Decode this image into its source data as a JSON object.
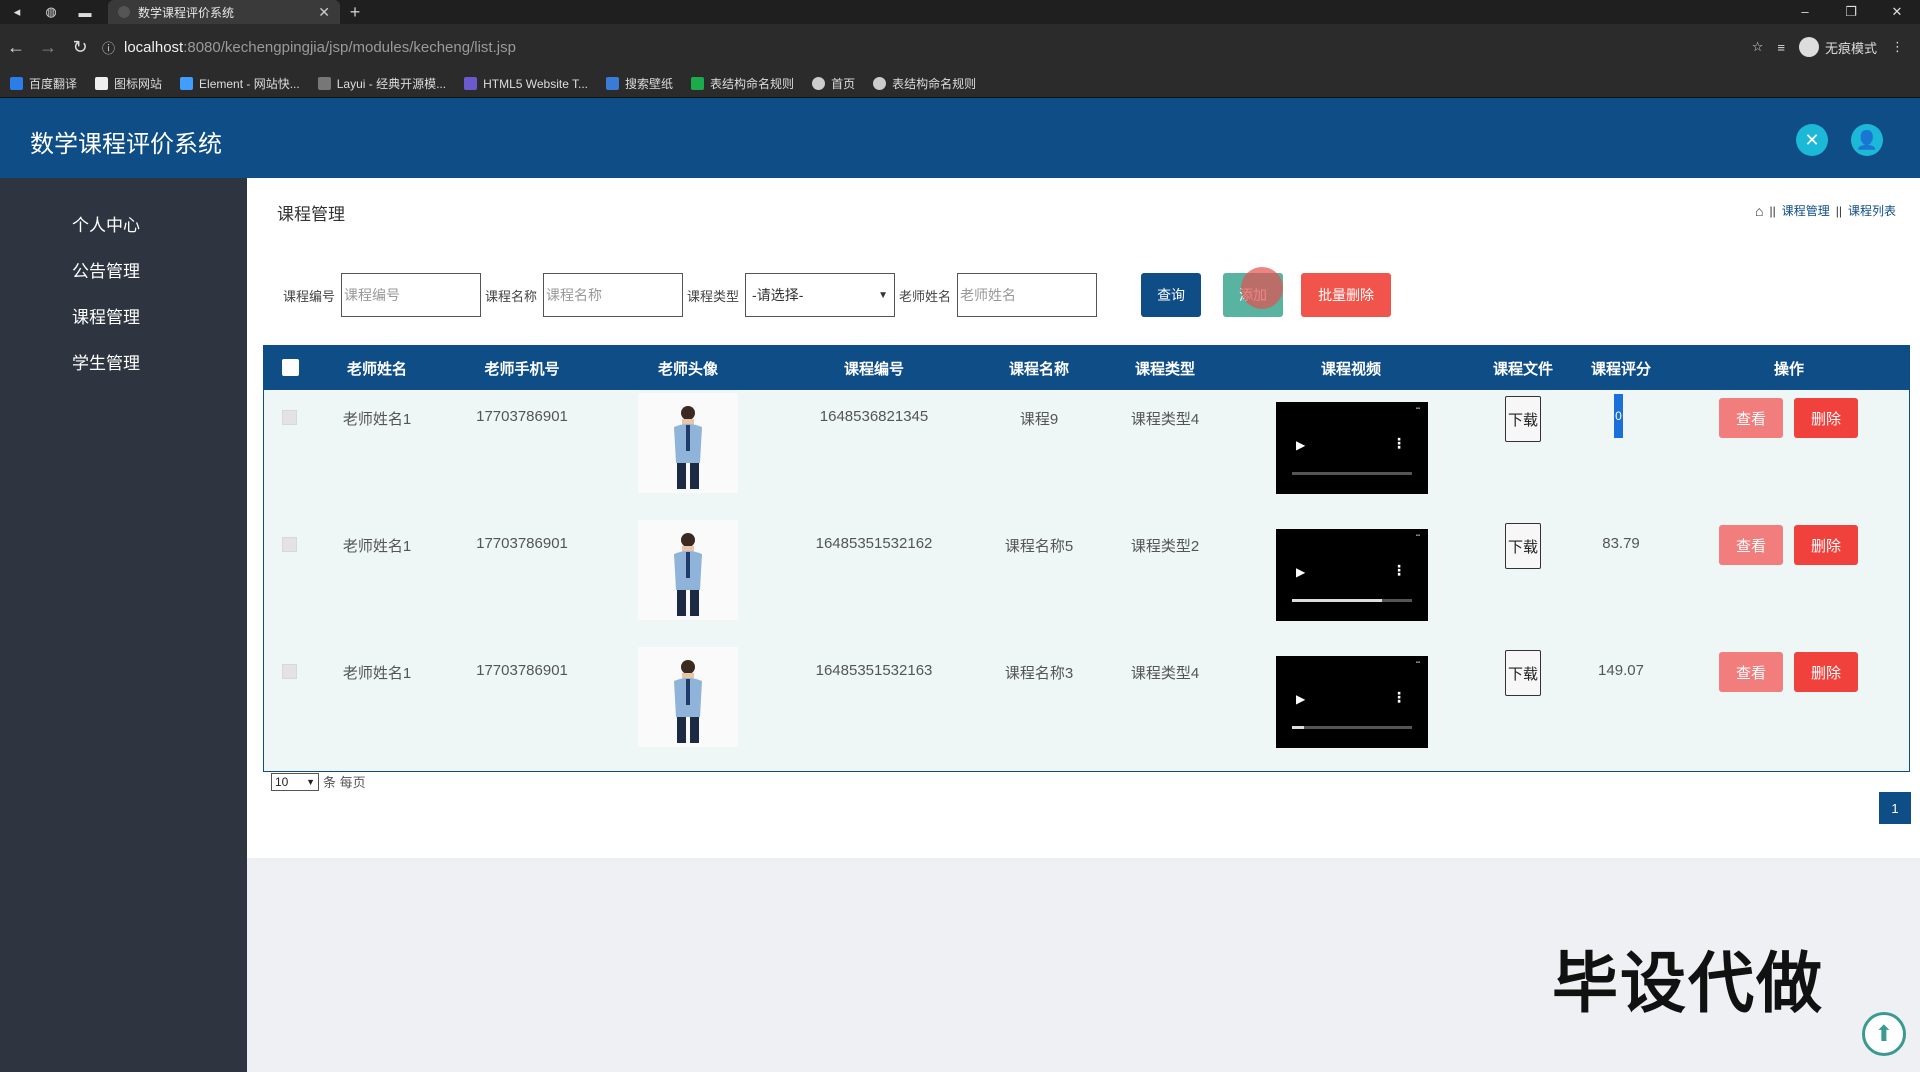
{
  "browser": {
    "tab_title": "数学课程评价系统",
    "url_host": "localhost",
    "url_path": ":8080/kechengpingjia/jsp/modules/kecheng/list.jsp",
    "profile_label": "无痕模式",
    "bookmarks": [
      "百度翻译",
      "图标网站",
      "Element - 网站快...",
      "Layui - 经典开源模...",
      "HTML5 Website T...",
      "搜索壁纸",
      "表结构命名规则",
      "首页",
      "表结构命名规则"
    ]
  },
  "app": {
    "title": "数学课程评价系统",
    "colors": {
      "header": "#0f4d86",
      "sidebar": "#2e3440",
      "accent": "#1bb8d8"
    }
  },
  "sidebar": {
    "items": [
      {
        "label": "个人中心"
      },
      {
        "label": "公告管理"
      },
      {
        "label": "课程管理"
      },
      {
        "label": "学生管理"
      }
    ]
  },
  "page": {
    "title": "课程管理",
    "breadcrumb": [
      "课程管理",
      "课程列表"
    ]
  },
  "search": {
    "course_no_label": "课程编号",
    "course_no_placeholder": "课程编号",
    "course_name_label": "课程名称",
    "course_name_placeholder": "课程名称",
    "course_type_label": "课程类型",
    "course_type_value": "-请选择-",
    "teacher_label": "老师姓名",
    "teacher_placeholder": "老师姓名",
    "query_label": "查询",
    "add_label": "添加",
    "batch_delete_label": "批量删除"
  },
  "table": {
    "headers": [
      "老师姓名",
      "老师手机号",
      "老师头像",
      "课程编号",
      "课程名称",
      "课程类型",
      "课程视频",
      "课程文件",
      "课程评分",
      "操作"
    ],
    "rows": [
      {
        "teacher": "老师姓名1",
        "phone": "17703786901",
        "course_no": "1648536821345",
        "course_name": "课程9",
        "course_type": "课程类型4",
        "file_label": "下载",
        "score": "0",
        "video_progress": 0.0
      },
      {
        "teacher": "老师姓名1",
        "phone": "17703786901",
        "course_no": "16485351532162",
        "course_name": "课程名称5",
        "course_type": "课程类型2",
        "file_label": "下载",
        "score": "83.79",
        "video_progress": 0.75
      },
      {
        "teacher": "老师姓名1",
        "phone": "17703786901",
        "course_no": "16485351532163",
        "course_name": "课程名称3",
        "course_type": "课程类型4",
        "file_label": "下载",
        "score": "149.07",
        "video_progress": 0.1
      }
    ],
    "view_label": "查看",
    "delete_label": "删除"
  },
  "pager": {
    "page_size": "10",
    "per_page_label": "条 每页",
    "current_page": "1"
  },
  "overlay": {
    "watermark": "毕设代做"
  }
}
